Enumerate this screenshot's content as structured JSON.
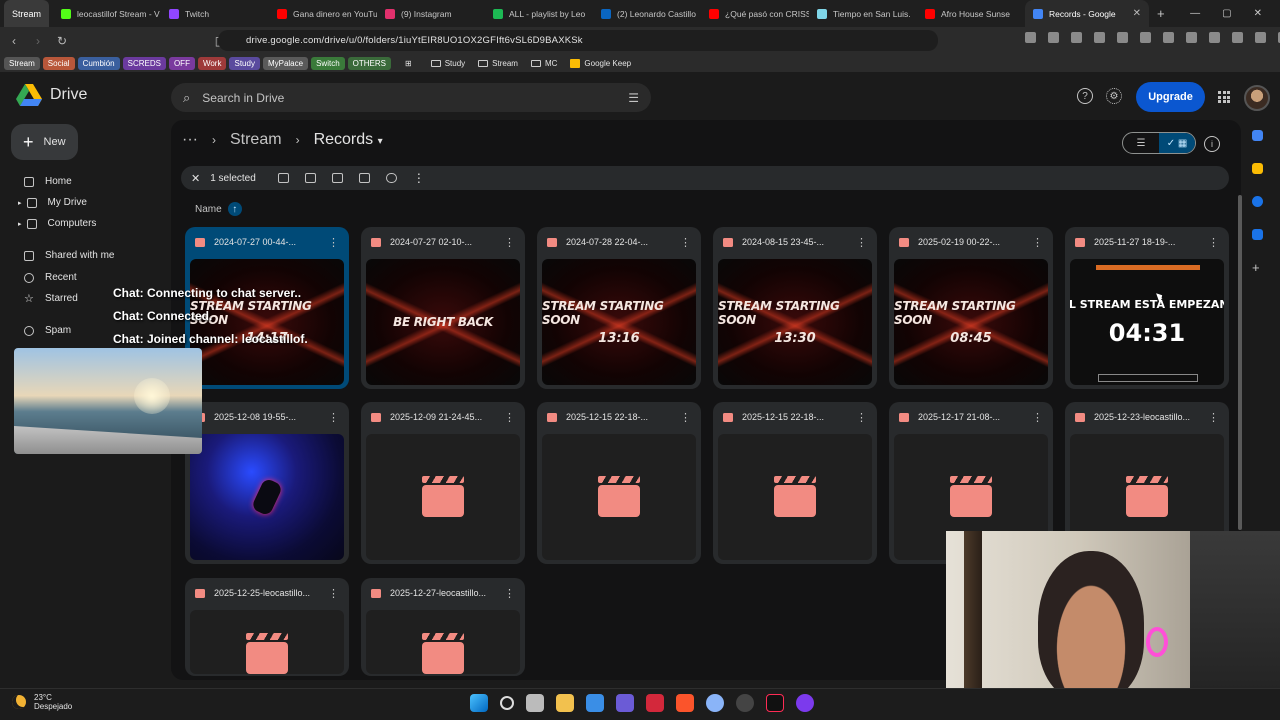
{
  "tabs": [
    {
      "label": "Stream",
      "style": "small",
      "color": ""
    },
    {
      "label": "leocastillof Stream - V",
      "color": "#53fc18"
    },
    {
      "label": "Twitch",
      "color": "#9146ff"
    },
    {
      "label": "Gana dinero en YouTu",
      "color": "#ff0000"
    },
    {
      "label": "(9) Instagram",
      "color": "#e1306c"
    },
    {
      "label": "ALL - playlist by Leo",
      "color": "#1db954"
    },
    {
      "label": "(2) Leonardo Castillo",
      "color": "#0a66c2"
    },
    {
      "label": "¿Qué pasó con CRISS",
      "color": "#ff0000"
    },
    {
      "label": "Tiempo en San Luis.",
      "color": "#7fd6e8"
    },
    {
      "label": "Afro House Sunse",
      "color": "#ff0000"
    },
    {
      "label": "Records - Google",
      "color": "#4285f4",
      "active": true
    }
  ],
  "address": {
    "url": "drive.google.com/drive/u/0/folders/1iuYtEIR8UO1OX2GFIft6vSL6D9BAXKSk"
  },
  "bookmarks": [
    {
      "label": "Stream",
      "color": "#555555"
    },
    {
      "label": "Social",
      "color": "#b8573a"
    },
    {
      "label": "Cumbión",
      "color": "#3a5f9e"
    },
    {
      "label": "SCREDS",
      "color": "#6b3a9e"
    },
    {
      "label": "OFF",
      "color": "#7a3a9e"
    },
    {
      "label": "Work",
      "color": "#9e3a3a"
    },
    {
      "label": "Study",
      "color": "#5a4a9e"
    },
    {
      "label": "MyPalace",
      "color": "#5a5a5a"
    },
    {
      "label": "Switch",
      "color": "#3a7a3a"
    },
    {
      "label": "OTHERS",
      "color": "#3a6a3a"
    }
  ],
  "bookmark_folders": [
    "Study",
    "Stream",
    "MC",
    "Google Keep"
  ],
  "drive": {
    "app_name": "Drive",
    "search_placeholder": "Search in Drive",
    "upgrade_label": "Upgrade",
    "new_label": "New",
    "nav": [
      {
        "label": "Home"
      },
      {
        "label": "My Drive"
      },
      {
        "label": "Computers"
      },
      {
        "label": "Shared with me"
      },
      {
        "label": "Recent"
      },
      {
        "label": "Starred"
      },
      {
        "label": "Spam"
      }
    ],
    "breadcrumb": {
      "parent": "Stream",
      "current": "Records"
    },
    "selection": {
      "text": "1 selected"
    },
    "sort_label": "Name",
    "files": [
      {
        "name": "2024-07-27 00-44-...",
        "thumb": "sss",
        "big": "STREAM STARTING SOON",
        "time": "14:17",
        "selected": true
      },
      {
        "name": "2024-07-27 02-10-...",
        "thumb": "sss",
        "big": "BE RIGHT BACK",
        "time": ""
      },
      {
        "name": "2024-07-28 22-04-...",
        "thumb": "sss",
        "big": "STREAM STARTING SOON",
        "time": "13:16"
      },
      {
        "name": "2024-08-15 23-45-...",
        "thumb": "sss",
        "big": "STREAM STARTING SOON",
        "time": "13:30"
      },
      {
        "name": "2025-02-19 00-22-...",
        "thumb": "sss",
        "big": "STREAM STARTING SOON",
        "time": "08:45"
      },
      {
        "name": "2025-11-27 18-19-...",
        "thumb": "empezani",
        "big": "EL STREAM ESTÁ EMPEZANI",
        "time": "04:31"
      },
      {
        "name": "2025-12-08 19-55-...",
        "thumb": "spidey",
        "big": "",
        "time": ""
      },
      {
        "name": "2025-12-09 21-24-45...",
        "thumb": "blank"
      },
      {
        "name": "2025-12-15 22-18-...",
        "thumb": "blank"
      },
      {
        "name": "2025-12-15 22-18-...",
        "thumb": "blank"
      },
      {
        "name": "2025-12-17 21-08-...",
        "thumb": "blank"
      },
      {
        "name": "2025-12-23-leocastillo...",
        "thumb": "blank"
      },
      {
        "name": "2025-12-25-leocastillo...",
        "thumb": "blank"
      },
      {
        "name": "2025-12-27-leocastillo...",
        "thumb": "blank"
      }
    ]
  },
  "chat_overlay": [
    "Chat: Connecting to chat server..",
    "Chat: Connected.",
    "Chat: Joined channel: leocastillof."
  ],
  "taskbar": {
    "temp": "23°C",
    "condition": "Despejado"
  }
}
